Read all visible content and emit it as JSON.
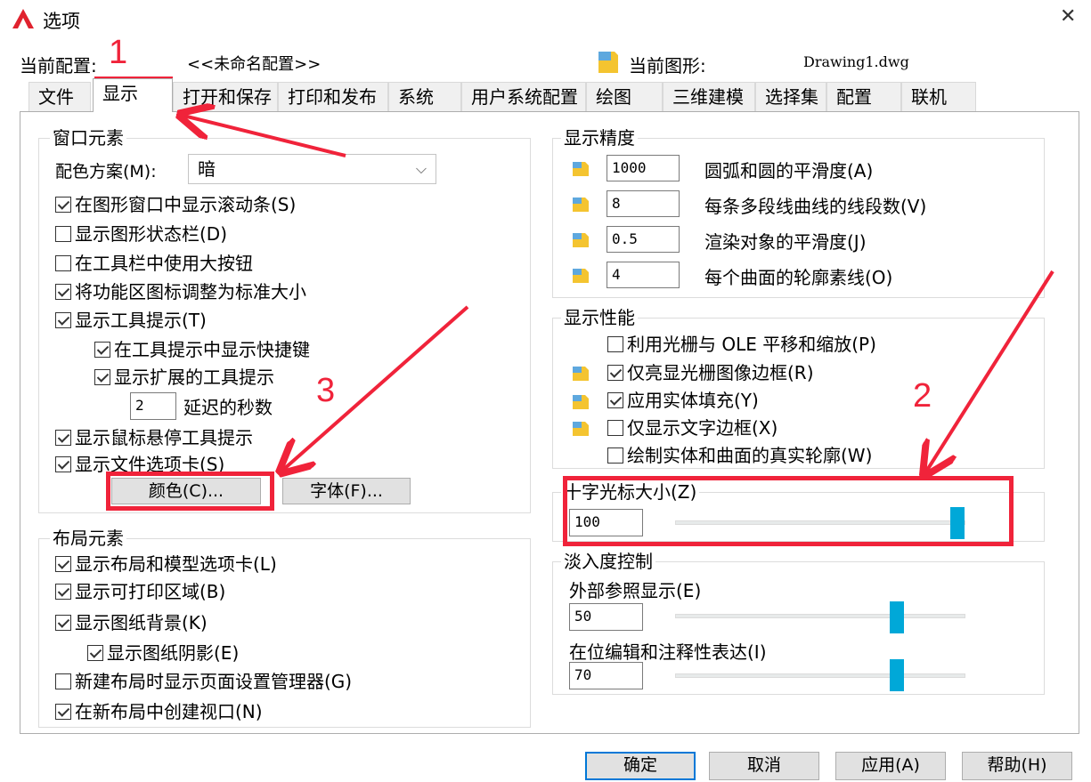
{
  "window": {
    "title": "选项",
    "close_label": "✕"
  },
  "profile": {
    "label": "当前配置:",
    "value": "<<未命名配置>>",
    "drawing_label": "当前图形:",
    "drawing_value": "Drawing1.dwg"
  },
  "tabs": [
    "文件",
    "显示",
    "打开和保存",
    "打印和发布",
    "系统",
    "用户系统配置",
    "绘图",
    "三维建模",
    "选择集",
    "配置",
    "联机"
  ],
  "window_elements": {
    "title": "窗口元素",
    "color_scheme_label": "配色方案(M):",
    "color_scheme_value": "暗",
    "options": [
      {
        "label": "在图形窗口中显示滚动条(S)",
        "checked": true
      },
      {
        "label": "显示图形状态栏(D)",
        "checked": false
      },
      {
        "label": "在工具栏中使用大按钮",
        "checked": false
      },
      {
        "label": "将功能区图标调整为标准大小",
        "checked": true
      },
      {
        "label": "显示工具提示(T)",
        "checked": true
      },
      {
        "label": "在工具提示中显示快捷键",
        "checked": true
      },
      {
        "label": "显示扩展的工具提示",
        "checked": true
      },
      {
        "label": "显示鼠标悬停工具提示",
        "checked": true
      },
      {
        "label": "显示文件选项卡(S)",
        "checked": true
      }
    ],
    "delay_value": "2",
    "delay_label": "延迟的秒数",
    "colors_button": "颜色(C)...",
    "fonts_button": "字体(F)..."
  },
  "layout_elements": {
    "title": "布局元素",
    "options": [
      {
        "label": "显示布局和模型选项卡(L)",
        "checked": true
      },
      {
        "label": "显示可打印区域(B)",
        "checked": true
      },
      {
        "label": "显示图纸背景(K)",
        "checked": true
      },
      {
        "label": "显示图纸阴影(E)",
        "checked": true
      },
      {
        "label": "新建布局时显示页面设置管理器(G)",
        "checked": false
      },
      {
        "label": "在新布局中创建视口(N)",
        "checked": true
      }
    ]
  },
  "display_resolution": {
    "title": "显示精度",
    "rows": [
      {
        "value": "1000",
        "label": "圆弧和圆的平滑度(A)"
      },
      {
        "value": "8",
        "label": "每条多段线曲线的线段数(V)"
      },
      {
        "value": "0.5",
        "label": "渲染对象的平滑度(J)"
      },
      {
        "value": "4",
        "label": "每个曲面的轮廓素线(O)"
      }
    ]
  },
  "display_performance": {
    "title": "显示性能",
    "options": [
      {
        "label": "利用光栅与 OLE 平移和缩放(P)",
        "checked": false
      },
      {
        "label": "仅亮显光栅图像边框(R)",
        "checked": true
      },
      {
        "label": "应用实体填充(Y)",
        "checked": true
      },
      {
        "label": "仅显示文字边框(X)",
        "checked": false
      },
      {
        "label": "绘制实体和曲面的真实轮廓(W)",
        "checked": false
      }
    ]
  },
  "crosshair": {
    "title": "十字光标大小(Z)",
    "value": "100",
    "level": 100
  },
  "fade": {
    "title": "淡入度控制",
    "xref_label": "外部参照显示(E)",
    "xref_value": "50",
    "xref_level": 50,
    "inplace_label": "在位编辑和注释性表达(I)",
    "inplace_value": "70",
    "inplace_level": 70
  },
  "buttons": {
    "ok": "确定",
    "cancel": "取消",
    "apply": "应用(A)",
    "help": "帮助(H)"
  },
  "annotations": {
    "n1": "1",
    "n2": "2",
    "n3": "3"
  },
  "colors": {
    "accent": "#0078d7",
    "slider": "#00a8d8",
    "annotation": "#f0233a"
  }
}
